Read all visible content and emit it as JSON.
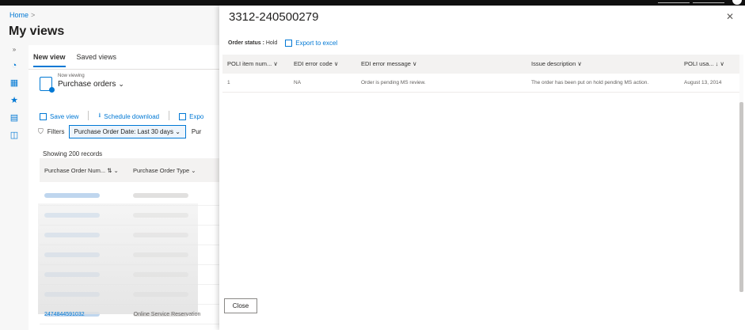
{
  "breadcrumb": {
    "home": "Home",
    "sep": ">"
  },
  "page_title": "My views",
  "rail": {
    "icons": [
      "expand-icon",
      "dashboard-icon",
      "grid-icon",
      "star-icon",
      "document-icon",
      "monitor-icon"
    ]
  },
  "tabs": {
    "new_view": "New view",
    "saved_views": "Saved views"
  },
  "viewing": {
    "label": "Now viewing",
    "value": "Purchase orders"
  },
  "actions": {
    "save_view": "Save view",
    "schedule_download": "Schedule download",
    "export": "Expo"
  },
  "filters": {
    "label": "Filters",
    "chip": "Purchase Order Date:  Last 30 days",
    "chip2": "Pur"
  },
  "records": "Showing 200 records",
  "grid": {
    "col1": "Purchase Order Num...",
    "col2": "Purchase Order Type"
  },
  "last_row": {
    "po": "2474844591032",
    "type": "Online Service Reservation"
  },
  "modal": {
    "title": "3312-240500279",
    "status_label": "Order status :",
    "status_value": "Hold",
    "export_label": "Export to excel",
    "columns": [
      "POLI item num...  ∨",
      "EDI error code  ∨",
      "EDI error message  ∨",
      "Issue description  ∨",
      "POLI usa...  ↓ ∨"
    ],
    "rows": [
      {
        "item": "1",
        "code": "NA",
        "message": "Order is pending MS review.",
        "issue": "The order has been put on hold pending MS action.",
        "usage": "August 13, 2014"
      }
    ],
    "close_label": "Close"
  }
}
